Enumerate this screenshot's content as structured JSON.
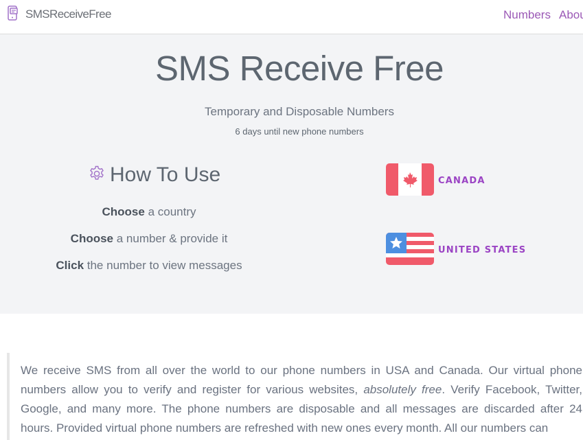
{
  "nav": {
    "brand": "SMSReceiveFree",
    "links": [
      "Numbers",
      "About"
    ]
  },
  "hero": {
    "title": "SMS Receive Free",
    "subtitle": "Temporary and Disposable Numbers",
    "countdown": "6 days until new phone numbers"
  },
  "howto": {
    "title": "How To Use",
    "steps": [
      {
        "bold": "Choose",
        "rest": " a country"
      },
      {
        "bold": "Choose",
        "rest": " a number & provide it"
      },
      {
        "bold": "Click",
        "rest": " the number to view messages"
      }
    ]
  },
  "countries": [
    {
      "name": "CANADA",
      "flag_icon": "canada-flag-icon"
    },
    {
      "name": "UNITED STATES",
      "flag_icon": "usa-flag-icon"
    }
  ],
  "about": {
    "text_before": "We receive SMS from all over the world to our phone numbers in USA and Canada. Our virtual phone numbers allow you to verify and register for various websites, ",
    "emphasis": "absolutely free",
    "text_after": ". Verify Facebook, Twitter, Google, and many more. The phone numbers are disposable and all messages are discarded after 24 hours. Provided virtual phone numbers are refreshed with new ones every month. All our numbers can"
  },
  "colors": {
    "accent": "#9b59b6",
    "country_label": "#9b44c4",
    "hero_bg": "#f3f4f6",
    "flag_red": "#f05a6a",
    "flag_blue": "#4d8fe0"
  }
}
